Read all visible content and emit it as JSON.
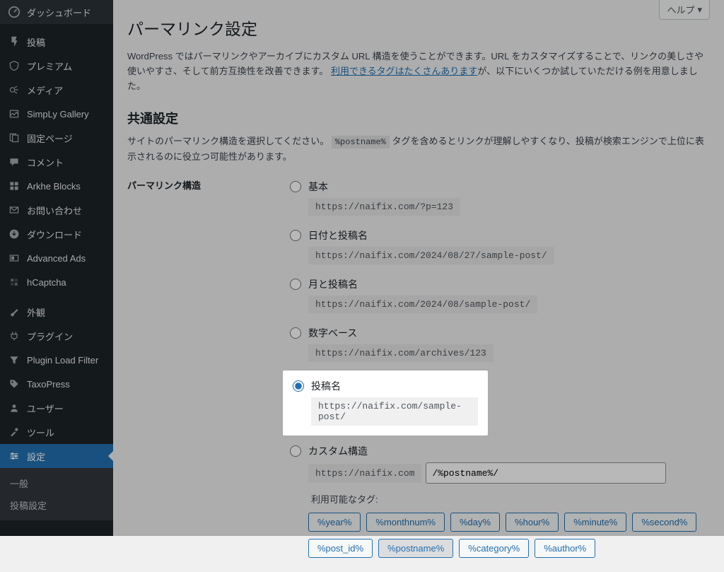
{
  "sidebar": {
    "items": [
      {
        "label": "ダッシュボード"
      },
      {
        "label": "投稿"
      },
      {
        "label": "プレミアム"
      },
      {
        "label": "メディア"
      },
      {
        "label": "SimpLy Gallery"
      },
      {
        "label": "固定ページ"
      },
      {
        "label": "コメント"
      },
      {
        "label": "Arkhe Blocks"
      },
      {
        "label": "お問い合わせ"
      },
      {
        "label": "ダウンロード"
      },
      {
        "label": "Advanced Ads"
      },
      {
        "label": "hCaptcha"
      },
      {
        "label": "外観"
      },
      {
        "label": "プラグイン"
      },
      {
        "label": "Plugin Load Filter"
      },
      {
        "label": "TaxoPress"
      },
      {
        "label": "ユーザー"
      },
      {
        "label": "ツール"
      },
      {
        "label": "設定"
      }
    ],
    "submenu": {
      "items": [
        {
          "label": "一般"
        },
        {
          "label": "投稿設定"
        }
      ]
    }
  },
  "help_label": "ヘルプ",
  "page_title": "パーマリンク設定",
  "intro_part1": "WordPress ではパーマリンクやアーカイブにカスタム URL 構造を使うことができます。URL をカスタマイズすることで、リンクの美しさや使いやすさ、そして前方互換性を改善できます。",
  "intro_link": "利用できるタグはたくさんあります",
  "intro_part2": "が、以下にいくつか試していただける例を用意しました。",
  "common_heading": "共通設定",
  "common_desc_a": "サイトのパーマリンク構造を選択してください。",
  "postname_tag": "%postname%",
  "common_desc_b": "タグを含めるとリンクが理解しやすくなり、投稿が検索エンジンで上位に表示されるのに役立つ可能性があります。",
  "structure_label": "パーマリンク構造",
  "options": {
    "plain": {
      "label": "基本",
      "code": "https://naifix.com/?p=123"
    },
    "dayname": {
      "label": "日付と投稿名",
      "code": "https://naifix.com/2024/08/27/sample-post/"
    },
    "monthname": {
      "label": "月と投稿名",
      "code": "https://naifix.com/2024/08/sample-post/"
    },
    "numeric": {
      "label": "数字ベース",
      "code": "https://naifix.com/archives/123"
    },
    "postname": {
      "label": "投稿名",
      "code": "https://naifix.com/sample-post/"
    },
    "custom": {
      "label": "カスタム構造",
      "prefix": "https://naifix.com",
      "value": "/%postname%/"
    }
  },
  "available_tags_label": "利用可能なタグ:",
  "tags_row1": [
    "%year%",
    "%monthnum%",
    "%day%",
    "%hour%",
    "%minute%",
    "%second%"
  ],
  "tags_row2": [
    "%post_id%",
    "%postname%",
    "%category%",
    "%author%"
  ]
}
